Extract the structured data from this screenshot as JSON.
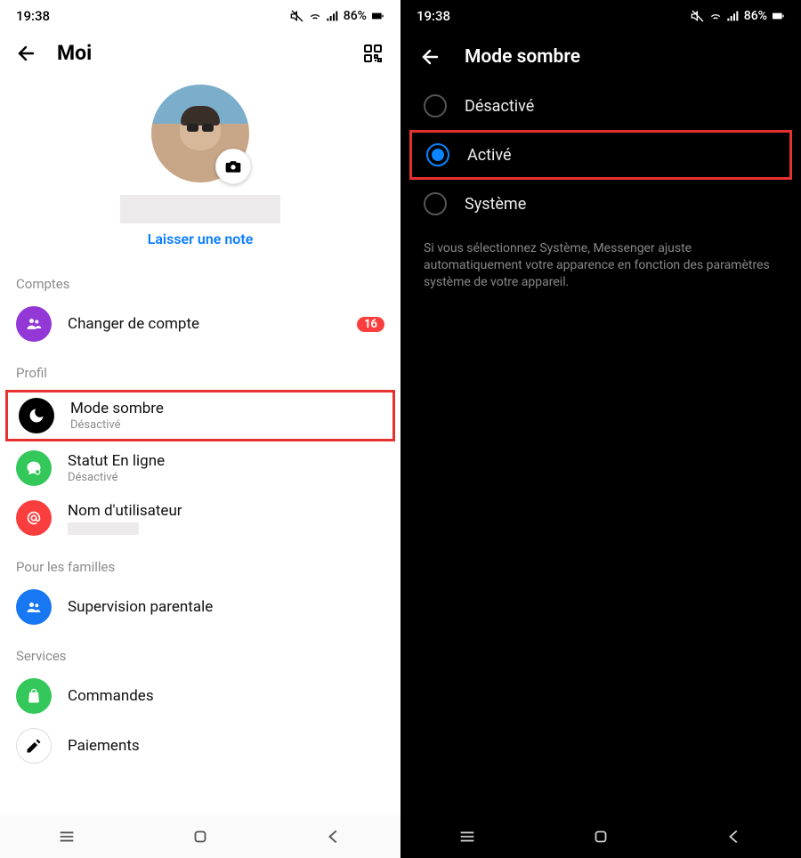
{
  "status": {
    "time": "19:38",
    "battery": "86%"
  },
  "left": {
    "title": "Moi",
    "leave_note": "Laisser une note",
    "sections": {
      "comptes": "Comptes",
      "profil": "Profil",
      "familles": "Pour les familles",
      "services": "Services"
    },
    "rows": {
      "switch_account": {
        "label": "Changer de compte",
        "badge": "16"
      },
      "dark_mode": {
        "label": "Mode sombre",
        "sub": "Désactivé"
      },
      "status_online": {
        "label": "Statut En ligne",
        "sub": "Désactivé"
      },
      "username": {
        "label": "Nom d'utilisateur"
      },
      "supervision": {
        "label": "Supervision parentale"
      },
      "orders": {
        "label": "Commandes"
      },
      "payments": {
        "label": "Paiements"
      }
    }
  },
  "right": {
    "title": "Mode sombre",
    "options": {
      "off": "Désactivé",
      "on": "Activé",
      "system": "Système"
    },
    "helper": "Si vous sélectionnez Système, Messenger ajuste automatiquement votre apparence en fonction des paramètres système de votre appareil."
  }
}
